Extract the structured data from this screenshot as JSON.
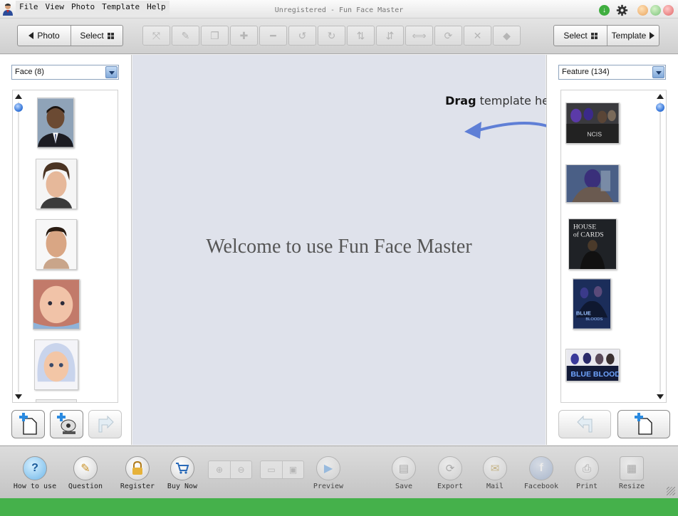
{
  "window": {
    "title": "Unregistered - Fun Face Master"
  },
  "menu": [
    "File",
    "View",
    "Photo",
    "Template",
    "Help"
  ],
  "toolbar": {
    "photo_label": "Photo",
    "select_left_label": "Select",
    "select_right_label": "Select",
    "template_label": "Template",
    "edit_tools": [
      "move-icon",
      "brush-icon",
      "copy-icon",
      "zoom-in-icon",
      "zoom-out-icon",
      "rotate-left-icon",
      "rotate-right-icon",
      "flip-vertical-icon",
      "flip-horizontal-icon",
      "expand-icon",
      "refresh-icon",
      "delete-icon",
      "drop-icon"
    ]
  },
  "left_panel": {
    "dropdown_value": "Face (8)",
    "thumbnails": [
      "face-1",
      "face-2",
      "face-3",
      "face-4",
      "face-5"
    ]
  },
  "right_panel": {
    "dropdown_value": "Feature (134)",
    "thumbnails": [
      "ncis",
      "robot",
      "house-of-cards",
      "blue-bloods-poster",
      "blue-bloods-banner"
    ]
  },
  "canvas": {
    "welcome_text": "Welcome to use Fun Face Master",
    "drag_bold": "Drag",
    "drag_rest": " template here"
  },
  "bottom": {
    "how_to_use": "How to use",
    "question": "Question",
    "register": "Register",
    "buy_now": "Buy Now",
    "preview": "Preview",
    "save": "Save",
    "export": "Export",
    "mail": "Mail",
    "facebook": "Facebook",
    "print": "Print",
    "resize": "Resize"
  },
  "colors": {
    "accent_blue": "#2c6fd6",
    "status_green": "#45b14b",
    "canvas_bg": "#dfe2eb"
  }
}
